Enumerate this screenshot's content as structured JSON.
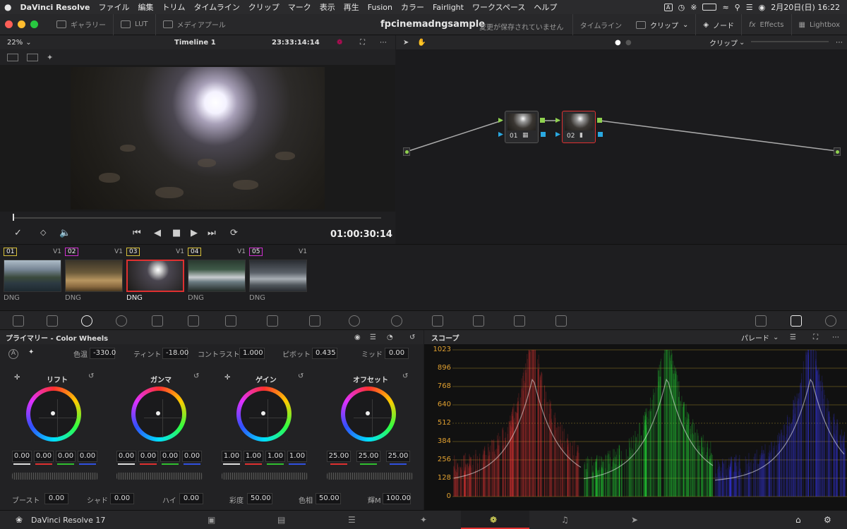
{
  "menubar": {
    "items": [
      "DaVinci Resolve",
      "ファイル",
      "編集",
      "トリム",
      "タイムライン",
      "クリップ",
      "マーク",
      "表示",
      "再生",
      "Fusion",
      "カラー",
      "Fairlight",
      "ワークスペース",
      "ヘルプ"
    ],
    "input_indicator": "A",
    "datetime": "2月20日(日) 16:22"
  },
  "toolbar": {
    "gallery": "ギャラリー",
    "lut": "LUT",
    "media_pool": "メディアプール",
    "project": "fpcinemadngsample",
    "unsaved": "変更が保存されていません",
    "timeline_link": "タイムライン",
    "clip": "クリップ",
    "node": "ノード",
    "effects": "Effects",
    "lightbox": "Lightbox"
  },
  "viewer": {
    "zoom": "22%",
    "timeline": "Timeline 1",
    "timecode": "23:33:14:14",
    "playhead_tc": "01:00:30:14"
  },
  "nodes": {
    "mode": "クリップ",
    "items": [
      {
        "label": "01"
      },
      {
        "label": "02"
      }
    ]
  },
  "clips": [
    {
      "num": "01",
      "track": "V1",
      "format": "DNG",
      "color": "#d8c038"
    },
    {
      "num": "02",
      "track": "V1",
      "format": "DNG",
      "color": "#d02fd0"
    },
    {
      "num": "03",
      "track": "V1",
      "format": "DNG",
      "color": "#d8c038",
      "selected": true
    },
    {
      "num": "04",
      "track": "V1",
      "format": "DNG",
      "color": "#d8c038"
    },
    {
      "num": "05",
      "track": "V1",
      "format": "DNG",
      "color": "#d02fd0"
    }
  ],
  "color_wheels": {
    "title": "プライマリー - Color Wheels",
    "params": [
      {
        "label": "色温",
        "value": "-330.0"
      },
      {
        "label": "ティント",
        "value": "-18.00"
      },
      {
        "label": "コントラスト",
        "value": "1.000"
      },
      {
        "label": "ピボット",
        "value": "0.435"
      },
      {
        "label": "ミッド",
        "value": "0.00"
      }
    ],
    "wheels": [
      {
        "name": "リフト",
        "values": [
          "0.00",
          "0.00",
          "0.00",
          "0.00"
        ]
      },
      {
        "name": "ガンマ",
        "values": [
          "0.00",
          "0.00",
          "0.00",
          "0.00"
        ]
      },
      {
        "name": "ゲイン",
        "values": [
          "1.00",
          "1.00",
          "1.00",
          "1.00"
        ]
      },
      {
        "name": "オフセット",
        "values": [
          "25.00",
          "25.00",
          "25.00"
        ]
      }
    ],
    "bottom_params": [
      {
        "label": "ブースト",
        "value": "0.00"
      },
      {
        "label": "シャド",
        "value": "0.00"
      },
      {
        "label": "ハイ",
        "value": "0.00"
      },
      {
        "label": "彩度",
        "value": "50.00"
      },
      {
        "label": "色相",
        "value": "50.00"
      },
      {
        "label": "輝M",
        "value": "100.00"
      }
    ]
  },
  "scope": {
    "title": "スコープ",
    "mode": "パレード",
    "scale": [
      "1023",
      "896",
      "768",
      "640",
      "512",
      "384",
      "256",
      "128",
      "0"
    ]
  },
  "bottombar": {
    "app_name": "DaVinci Resolve 17"
  }
}
